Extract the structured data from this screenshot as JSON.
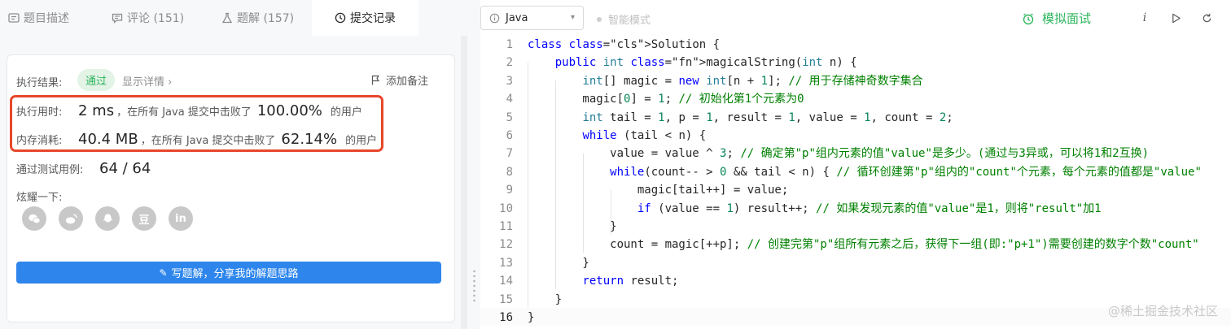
{
  "tabs": [
    {
      "label": "题目描述",
      "icon": "description-icon"
    },
    {
      "label": "评论 (151)",
      "icon": "comment-icon"
    },
    {
      "label": "题解 (157)",
      "icon": "flask-icon"
    },
    {
      "label": "提交记录",
      "icon": "clock-icon"
    }
  ],
  "result": {
    "label": "执行结果:",
    "status": "通过",
    "detail_link": "显示详情 ›",
    "note_button": "添加备注"
  },
  "runtime": {
    "label": "执行用时:",
    "value": "2 ms",
    "text": "，在所有 Java 提交中击败了",
    "percent": "100.00%",
    "suffix": "的用户"
  },
  "memory": {
    "label": "内存消耗:",
    "value": "40.4 MB",
    "text": "，在所有 Java 提交中击败了",
    "percent": "62.14%",
    "suffix": "的用户"
  },
  "testcases": {
    "label": "通过测试用例:",
    "value": "64 / 64"
  },
  "share": {
    "title": "炫耀一下:",
    "icons": [
      "wechat-icon",
      "weibo-icon",
      "qq-icon",
      "douban-icon",
      "linkedin-icon"
    ],
    "icon_glyphs": [
      "",
      "",
      "",
      "豆",
      "in"
    ]
  },
  "write_button": "写题解，分享我的解题思路",
  "toolbar": {
    "language": "Java",
    "smart_mode": "智能模式",
    "mock_interview": "模拟面试",
    "info_glyph": "i"
  },
  "colors": {
    "accent_green": "#2db55d",
    "primary_blue": "#2e86ec",
    "highlight_red": "#e8472b"
  },
  "code": {
    "line_numbers": [
      "1",
      "2",
      "3",
      "4",
      "5",
      "6",
      "7",
      "8",
      "9",
      "10",
      "11",
      "12",
      "13",
      "14",
      "15",
      "16"
    ],
    "current_line": "16",
    "lines": [
      "class Solution {",
      "    public int magicalString(int n) {",
      "        int[] magic = new int[n + 1]; // 用于存储神奇数字集合",
      "        magic[0] = 1; // 初始化第1个元素为0",
      "        int tail = 1, p = 1, result = 1, value = 1, count = 2;",
      "        while (tail < n) {",
      "            value = value ^ 3; // 确定第\"p\"组内元素的值\"value\"是多少。(通过与3异或，可以将1和2互换)",
      "            while(count-- > 0 && tail < n) { // 循环创建第\"p\"组内的\"count\"个元素，每个元素的值都是\"value\"",
      "                magic[tail++] = value;",
      "                if (value == 1) result++; // 如果发现元素的值\"value\"是1，则将\"result\"加1",
      "            }",
      "            count = magic[++p]; // 创建完第\"p\"组所有元素之后，获得下一组(即:\"p+1\")需要创建的数字个数\"count\"",
      "        }",
      "        return result;",
      "    }",
      "}"
    ]
  },
  "watermark": "@稀土掘金技术社区"
}
